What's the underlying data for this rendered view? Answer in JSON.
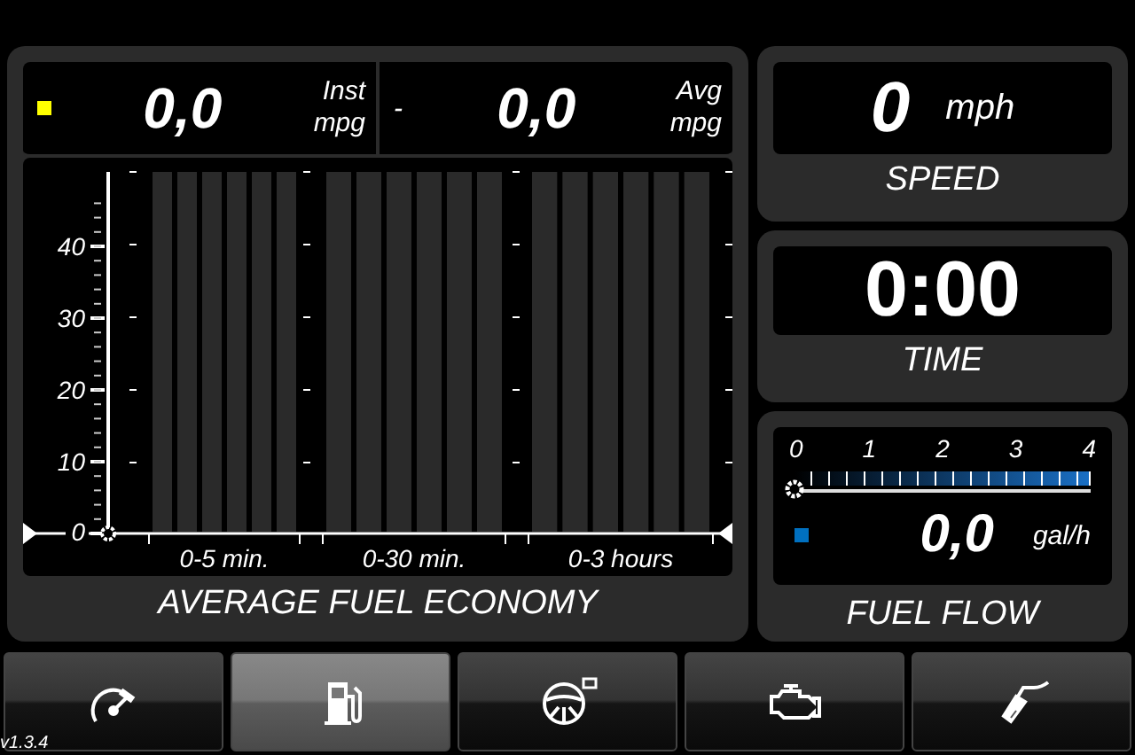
{
  "economy": {
    "instant": {
      "value": "0,0",
      "label": "Inst",
      "unit": "mpg",
      "color": "#ffff00"
    },
    "separator": "-",
    "average": {
      "value": "0,0",
      "label": "Avg",
      "unit": "mpg"
    },
    "chart": {
      "y_labels": [
        "40",
        "30",
        "20",
        "10",
        "0"
      ],
      "periods": [
        "0-5 min.",
        "0-30 min.",
        "0-3 hours"
      ]
    },
    "title": "AVERAGE FUEL ECONOMY"
  },
  "speed": {
    "value": "0",
    "unit": "mph",
    "title": "SPEED"
  },
  "time": {
    "value": "0:00",
    "title": "TIME"
  },
  "fuel_flow": {
    "scale": [
      "0",
      "1",
      "2",
      "3",
      "4"
    ],
    "level": 0,
    "value": "0,0",
    "unit": "gal/h",
    "color": "#0070c0",
    "title": "FUEL FLOW"
  },
  "nav": [
    {
      "kind": "gauge",
      "selected": false
    },
    {
      "kind": "pump",
      "selected": true
    },
    {
      "kind": "wheel",
      "selected": false
    },
    {
      "kind": "engine",
      "selected": false
    },
    {
      "kind": "nozzle",
      "selected": false
    }
  ],
  "version": "v1.3.4"
}
